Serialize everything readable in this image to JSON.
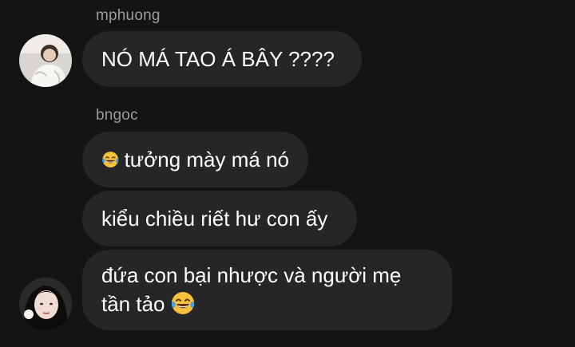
{
  "conversation": {
    "messages": [
      {
        "sender": "mphuong",
        "text": "NÓ MÁ TAO Á BÂY ????"
      },
      {
        "sender": "bngoc",
        "text": "tưởng mày má nó",
        "emoji": "face-with-tears-of-joy"
      },
      {
        "text": "kiểu chiều riết hư con ấy"
      },
      {
        "line1": "đứa con bại nhược và người mẹ",
        "line2": "tần tảo",
        "emoji": "face-with-tears-of-joy"
      }
    ]
  },
  "colors": {
    "background": "#141414",
    "bubble": "#262628",
    "text": "#ffffff",
    "sender": "#9b9ba0"
  }
}
